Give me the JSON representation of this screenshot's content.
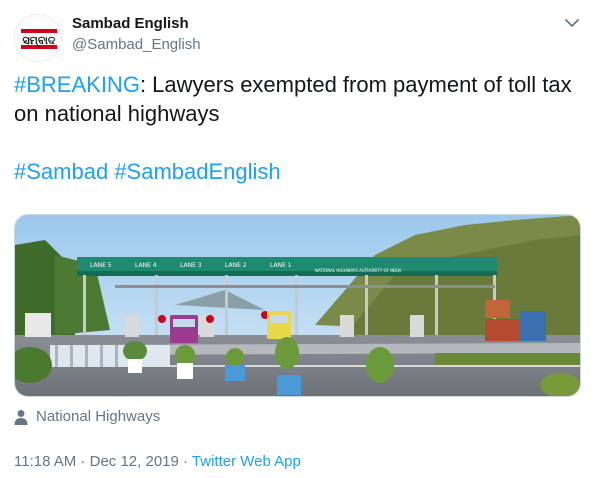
{
  "author": {
    "display_name": "Sambad English",
    "handle": "@Sambad_English",
    "avatar_logo_text": "ସମ୍ବାଦ"
  },
  "tweet": {
    "breaking_tag": "#BREAKING",
    "headline_rest": ": Lawyers exempted from payment of toll tax on national highways",
    "hashtag_1": "#Sambad",
    "hashtag_2": "#SambadEnglish"
  },
  "media": {
    "alt": "Toll plaza on a national highway with lanes and vehicles",
    "gantry_lanes": [
      "LANE 5",
      "LANE 4",
      "LANE 3",
      "LANE 2",
      "LANE 1"
    ],
    "gantry_sign": "NATIONAL HIGHWAYS AUTHORITY OF INDIA"
  },
  "location": {
    "label": "National Highways"
  },
  "meta": {
    "time": "11:18 AM",
    "separator": " · ",
    "date": "Dec 12, 2019",
    "source": "Twitter Web App"
  },
  "colors": {
    "link": "#1da1f2",
    "muted": "#657786",
    "text": "#14171a"
  }
}
